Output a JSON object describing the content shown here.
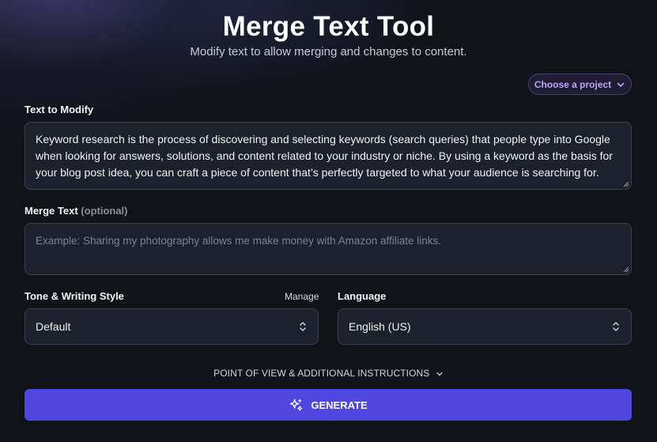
{
  "header": {
    "title": "Merge Text Tool",
    "subtitle": "Modify text to allow merging and changes to content."
  },
  "project_selector": {
    "label": "Choose a project",
    "icon": "chevron-down-icon"
  },
  "text_to_modify": {
    "label": "Text to Modify",
    "value": "Keyword research is the process of discovering and selecting keywords (search queries) that people type into Google when looking for answers, solutions, and content related to your industry or niche. By using a keyword as the basis for your blog post idea, you can craft a piece of content that’s perfectly targeted to what your audience is searching for."
  },
  "merge_text": {
    "label": "Merge Text",
    "optional_label": "(optional)",
    "value": "",
    "placeholder": "Example: Sharing my photography allows me make money with Amazon affiliate links."
  },
  "tone": {
    "label": "Tone & Writing Style",
    "manage_label": "Manage",
    "selected": "Default"
  },
  "language": {
    "label": "Language",
    "selected": "English (US)"
  },
  "additional": {
    "label": "POINT OF VIEW & ADDITIONAL INSTRUCTIONS"
  },
  "generate": {
    "label": "GENERATE",
    "icon": "sparkles-icon"
  },
  "colors": {
    "background": "#111319",
    "accent": "#5047e0",
    "project_text": "#b9a6f5",
    "field_background": "#1c212b"
  }
}
